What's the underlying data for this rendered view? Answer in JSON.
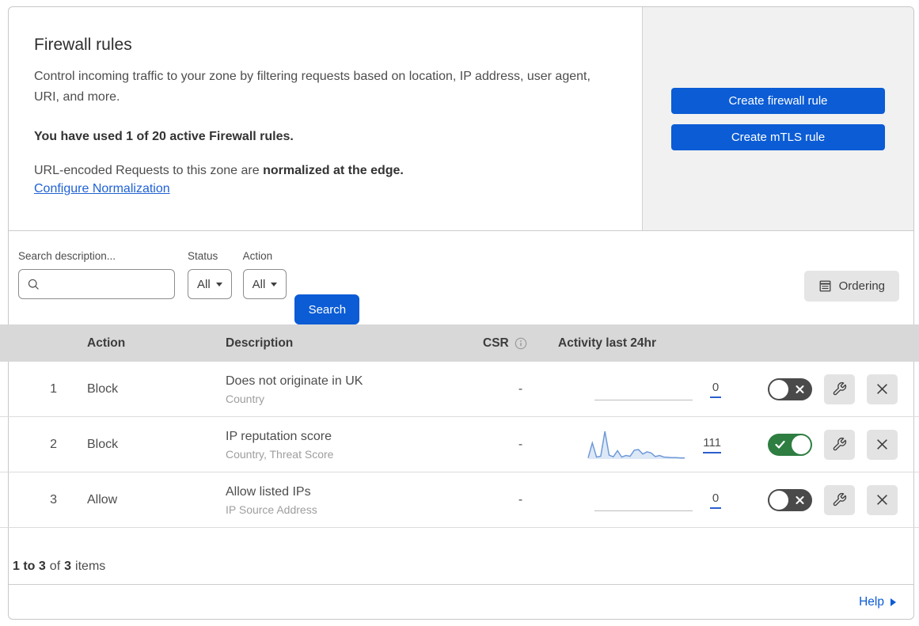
{
  "colors": {
    "accent_blue": "#0b5cd5",
    "link_blue": "#2062d4",
    "toggle_on_green": "#2e7d41",
    "toggle_off_gray": "#4a4a4a",
    "sparkline_blue": "#6f9ad8",
    "table_header_gray": "#d8d8d8"
  },
  "hero": {
    "title": "Firewall rules",
    "description": "Control incoming traffic to your zone by filtering requests based on location, IP address, user agent, URI, and more.",
    "usage_notice": "You have used 1 of 20 active Firewall rules.",
    "normalization_prefix": "URL-encoded Requests to this zone are",
    "normalization_bold": "normalized at the edge.",
    "normalization_link": "Configure Normalization",
    "create_firewall_button": "Create firewall rule",
    "create_mtls_button": "Create mTLS rule"
  },
  "filters": {
    "search_label": "Search description...",
    "status_label": "Status",
    "status_value": "All",
    "action_label": "Action",
    "action_value": "All",
    "search_button": "Search",
    "ordering_button": "Ordering"
  },
  "table": {
    "headers": {
      "action": "Action",
      "description": "Description",
      "csr": "CSR",
      "activity": "Activity last 24hr"
    },
    "rows": [
      {
        "num": "1",
        "action": "Block",
        "description": "Does not originate in UK",
        "fields": "Country",
        "csr": "-",
        "activity_count": "0",
        "enabled": false
      },
      {
        "num": "2",
        "action": "Block",
        "description": "IP reputation score",
        "fields": "Country, Threat Score",
        "csr": "-",
        "activity_count": "111",
        "enabled": true,
        "sparkline": [
          0.04,
          0.58,
          0.07,
          0.1,
          1.0,
          0.14,
          0.08,
          0.3,
          0.07,
          0.13,
          0.1,
          0.32,
          0.34,
          0.18,
          0.26,
          0.22,
          0.09,
          0.13,
          0.07,
          0.06,
          0.05,
          0.05,
          0.04,
          0.04
        ]
      },
      {
        "num": "3",
        "action": "Allow",
        "description": "Allow listed IPs",
        "fields": "IP Source Address",
        "csr": "-",
        "activity_count": "0",
        "enabled": false
      }
    ]
  },
  "footer": {
    "range": "1 to 3",
    "of_word": "of",
    "total": "3",
    "items_word": "items",
    "help_label": "Help"
  }
}
